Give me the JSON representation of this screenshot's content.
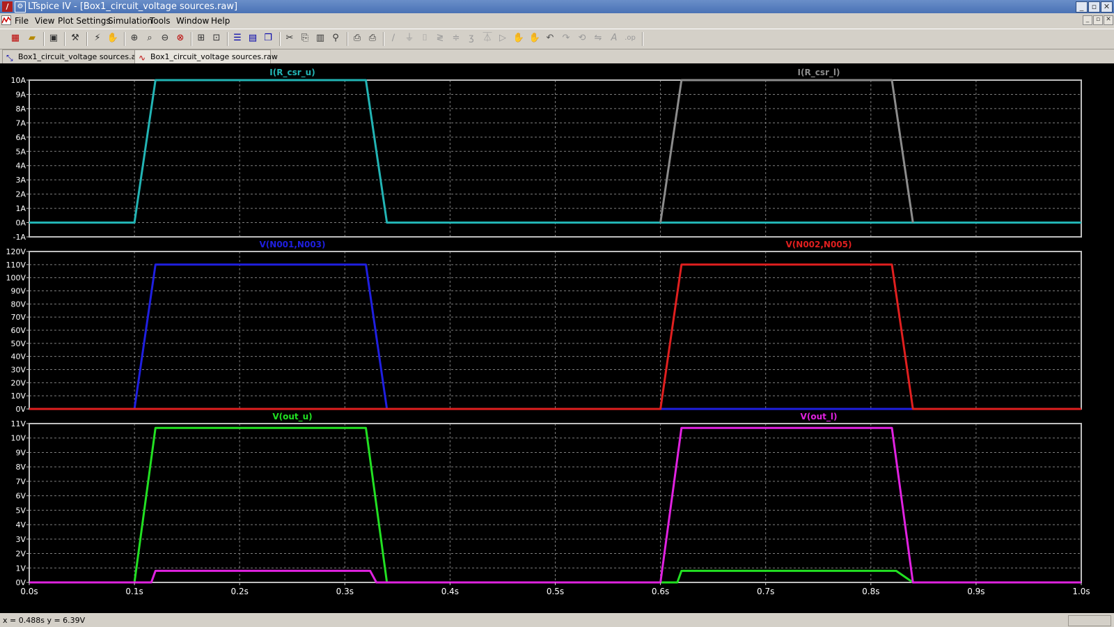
{
  "window": {
    "title": "LTspice IV - [Box1_circuit_voltage sources.raw]"
  },
  "menu": {
    "items": [
      "File",
      "View",
      "Plot Settings",
      "Simulation",
      "Tools",
      "Window",
      "Help"
    ]
  },
  "tabs": [
    {
      "label": "Box1_circuit_voltage sources.asc",
      "icon": "schematic-icon",
      "active": false
    },
    {
      "label": "Box1_circuit_voltage sources.raw",
      "icon": "waveform-icon",
      "active": true
    }
  ],
  "toolbar": {
    "icons": [
      "new-schematic-icon",
      "open-icon",
      "save-icon",
      "control-panel-icon",
      "run-icon",
      "halt-icon",
      "zoom-in-icon",
      "zoom-to-fit-icon",
      "zoom-out-icon",
      "cancel-zoom-icon",
      "autorange-icon",
      "mark-icon",
      "tile-horizontal-icon",
      "tile-vertical-icon",
      "cascade-icon",
      "cut-icon",
      "copy-icon",
      "paste-icon",
      "find-icon",
      "print-preview-icon",
      "print-icon",
      "wire-icon",
      "ground-icon",
      "label-icon",
      "resistor-icon",
      "capacitor-icon",
      "inductor-icon",
      "diode-icon",
      "component-icon",
      "move-icon",
      "drag-icon",
      "undo-icon",
      "redo-icon",
      "rotate-icon",
      "mirror-icon",
      "text-icon",
      "spice-directive-icon"
    ]
  },
  "status": {
    "text": "x = 0.488s    y = 6.39V"
  },
  "colors": {
    "plot_bg": "#000000",
    "grid": "#7f7f7f",
    "axis_text": "#ffffff"
  },
  "chart_data": [
    {
      "type": "line",
      "x_ticks": [
        "0.0s",
        "0.1s",
        "0.2s",
        "0.3s",
        "0.4s",
        "0.5s",
        "0.6s",
        "0.7s",
        "0.8s",
        "0.9s",
        "1.0s"
      ],
      "xlim": [
        0,
        1
      ],
      "ylim": [
        -1,
        10
      ],
      "y_ticks": [
        "-1A",
        "0A",
        "1A",
        "2A",
        "3A",
        "4A",
        "5A",
        "6A",
        "7A",
        "8A",
        "9A",
        "10A"
      ],
      "y_tick_values": [
        -1,
        0,
        1,
        2,
        3,
        4,
        5,
        6,
        7,
        8,
        9,
        10
      ],
      "grid": true,
      "series": [
        {
          "name": "I(R_csr_u)",
          "color": "#22b4b4",
          "x": [
            0,
            0.1,
            0.12,
            0.32,
            0.34,
            1.0
          ],
          "y": [
            0,
            0,
            10,
            10,
            0,
            0
          ]
        },
        {
          "name": "I(R_csr_l)",
          "color": "#8c8c8c",
          "x": [
            0.6,
            0.62,
            0.82,
            0.84
          ],
          "y": [
            0,
            10,
            10,
            0
          ]
        }
      ]
    },
    {
      "type": "line",
      "x_ticks": [
        "0.0s",
        "0.1s",
        "0.2s",
        "0.3s",
        "0.4s",
        "0.5s",
        "0.6s",
        "0.7s",
        "0.8s",
        "0.9s",
        "1.0s"
      ],
      "xlim": [
        0,
        1
      ],
      "ylim": [
        0,
        120
      ],
      "y_ticks": [
        "0V",
        "10V",
        "20V",
        "30V",
        "40V",
        "50V",
        "60V",
        "70V",
        "80V",
        "90V",
        "100V",
        "110V",
        "120V"
      ],
      "y_tick_values": [
        0,
        10,
        20,
        30,
        40,
        50,
        60,
        70,
        80,
        90,
        100,
        110,
        120
      ],
      "grid": true,
      "series": [
        {
          "name": "V(N001,N003)",
          "color": "#1f1fe0",
          "x": [
            0,
            0.1,
            0.12,
            0.32,
            0.34,
            1.0
          ],
          "y": [
            0,
            0,
            110,
            110,
            0,
            0
          ]
        },
        {
          "name": "V(N002,N005)",
          "color": "#e01f1f",
          "x": [
            0,
            0.6,
            0.62,
            0.82,
            0.84,
            1.0
          ],
          "y": [
            0,
            0,
            110,
            110,
            0,
            0
          ]
        }
      ]
    },
    {
      "type": "line",
      "x_ticks": [
        "0.0s",
        "0.1s",
        "0.2s",
        "0.3s",
        "0.4s",
        "0.5s",
        "0.6s",
        "0.7s",
        "0.8s",
        "0.9s",
        "1.0s"
      ],
      "xlim": [
        0,
        1
      ],
      "ylim": [
        0,
        11
      ],
      "y_ticks": [
        "0V",
        "1V",
        "2V",
        "3V",
        "4V",
        "5V",
        "6V",
        "7V",
        "8V",
        "9V",
        "10V",
        "11V"
      ],
      "y_tick_values": [
        0,
        1,
        2,
        3,
        4,
        5,
        6,
        7,
        8,
        9,
        10,
        11
      ],
      "grid": true,
      "series": [
        {
          "name": "V(out_u)",
          "color": "#22e022",
          "x": [
            0,
            0.1,
            0.12,
            0.32,
            0.34,
            0.6,
            0.616,
            0.62,
            0.82,
            0.824,
            0.84,
            1.0
          ],
          "y": [
            0,
            0,
            10.7,
            10.7,
            0,
            0,
            0,
            0.8,
            0.8,
            0.8,
            0,
            0
          ]
        },
        {
          "name": "V(out_l)",
          "color": "#e022e0",
          "x": [
            0,
            0.116,
            0.12,
            0.32,
            0.324,
            0.33,
            0.6,
            0.62,
            0.82,
            0.84,
            1.0
          ],
          "y": [
            0,
            0,
            0.8,
            0.8,
            0.8,
            0,
            0,
            10.7,
            10.7,
            0,
            0
          ]
        }
      ]
    }
  ]
}
